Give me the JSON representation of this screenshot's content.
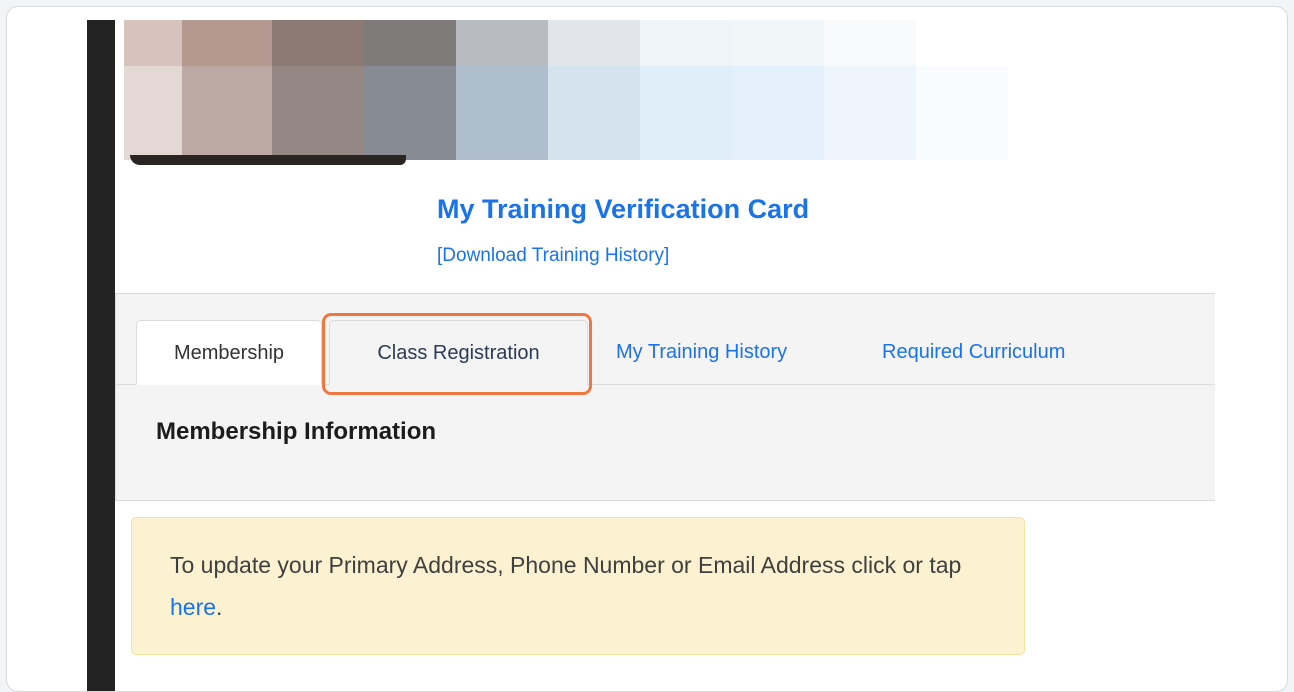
{
  "card": {
    "title": "My Training Verification Card",
    "download_label": "[Download Training History]"
  },
  "tabs": [
    {
      "label": "Membership",
      "active": true
    },
    {
      "label": "Class Registration",
      "active": false,
      "highlighted": true
    },
    {
      "label": "My Training History",
      "active": false
    },
    {
      "label": "Required Curriculum",
      "active": false
    }
  ],
  "section": {
    "heading": "Membership Information"
  },
  "alert": {
    "text_before": "To update your Primary Address, Phone Number or Email Address click or tap ",
    "link_text": "here",
    "text_after": "."
  },
  "colors": {
    "link": "#1a73e8",
    "highlight": "#f0773f",
    "alert_bg": "#fcf2d1"
  }
}
